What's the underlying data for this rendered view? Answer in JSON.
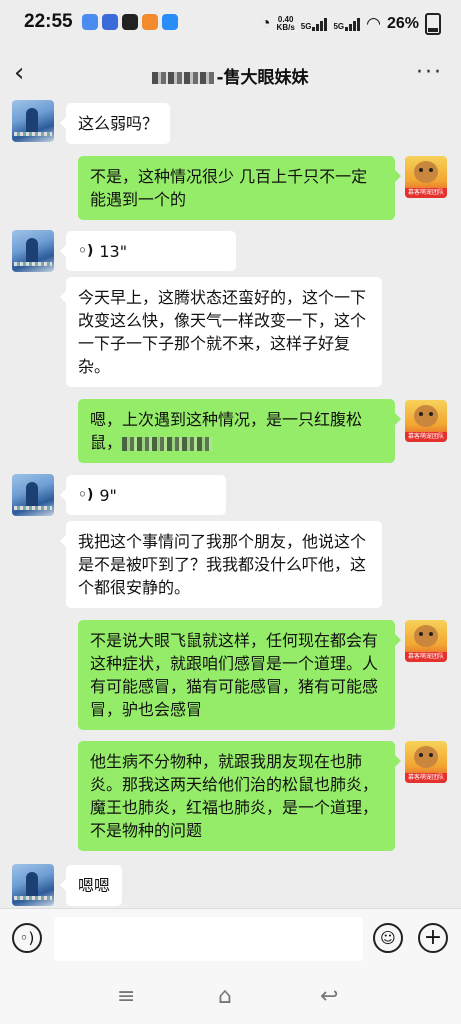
{
  "status_bar": {
    "time": "22:55",
    "net_speed_value": "0.40",
    "net_speed_unit": "KB/s",
    "sim1": "5G",
    "sim2": "5G",
    "battery": "26%"
  },
  "header": {
    "title": "-售大眼妹妹"
  },
  "messages": [
    {
      "side": "left",
      "type": "text",
      "text": "这么弱吗？"
    },
    {
      "side": "right",
      "type": "text",
      "text": "不是，这种情况很少   几百上千只不一定能遇到一个的"
    },
    {
      "side": "left",
      "type": "voice",
      "duration": "13\""
    },
    {
      "side": "left",
      "type": "text",
      "text": "今天早上，这腾状态还蛮好的，这个一下改变这么快，像天气一样改变一下，这个一下子一下子那个就不来，这样子好复杂。"
    },
    {
      "side": "right",
      "type": "text",
      "text": "嗯，上次遇到这种情况，是一只红腹松鼠，"
    },
    {
      "side": "left",
      "type": "voice",
      "duration": "9\""
    },
    {
      "side": "left",
      "type": "text",
      "text": "我把这个事情问了我那个朋友，他说这个是不是被吓到了？我我都没什么吓他，这个都很安静的。"
    },
    {
      "side": "right",
      "type": "text",
      "text": "不是说大眼飞鼠就这样，任何现在都会有这种症状，就跟咱们感冒是一个道理。人有可能感冒，猫有可能感冒，猪有可能感冒，驴也会感冒"
    },
    {
      "side": "right",
      "type": "text",
      "text": "他生病不分物种，就跟我朋友现在也肺炎。那我这两天给他们治的松鼠也肺炎，魔王也肺炎，红福也肺炎，是一个道理，不是物种的问题"
    },
    {
      "side": "left",
      "type": "text",
      "text": "嗯嗯"
    }
  ],
  "avatar_right_tag": "慕客萌宠团队",
  "icons": {
    "back": "chevron-left-icon",
    "more": "more-dots-icon",
    "voice": "voice-wave-icon",
    "emoji": "emoji-icon",
    "plus": "plus-icon"
  },
  "colors": {
    "own_bubble": "#95ec69",
    "other_bubble": "#ffffff",
    "background": "#ededed"
  }
}
